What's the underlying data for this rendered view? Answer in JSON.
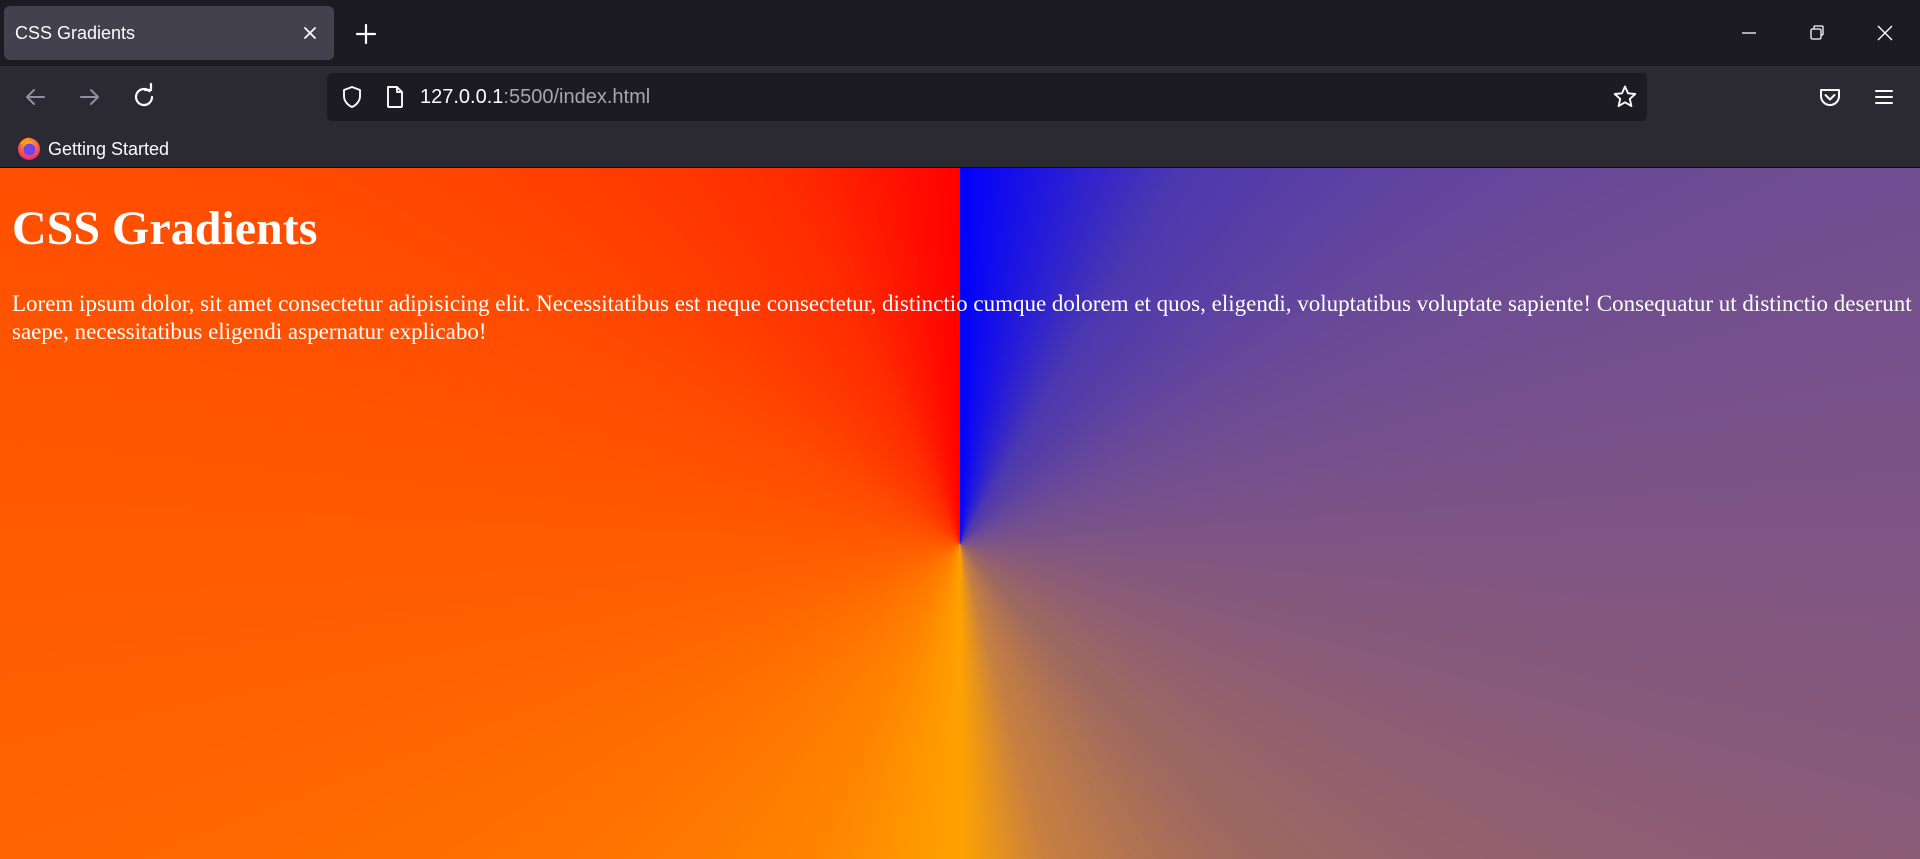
{
  "tab": {
    "title": "CSS Gradients"
  },
  "urlbar": {
    "host": "127.0.0.1",
    "path": ":5500/index.html"
  },
  "bookmarks": {
    "items": [
      {
        "label": "Getting Started",
        "icon": "firefox-icon"
      }
    ]
  },
  "page": {
    "heading": "CSS Gradients",
    "paragraph": "Lorem ipsum dolor, sit amet consectetur adipisicing elit. Necessitatibus est neque consectetur, distinctio cumque dolorem et quos, eligendi, voluptatibus voluptate sapiente! Consequatur ut distinctio deserunt saepe, necessitatibus eligendi aspernatur explicabo!"
  },
  "colors": {
    "chrome_dark": "#1c1b22",
    "toolbar": "#2b2a33",
    "active_tab": "#42414d",
    "text_light": "#fbfbfe",
    "gradient_blue": "#0000ff",
    "gradient_red": "#ff0000",
    "gradient_orange": "#ffa200"
  }
}
